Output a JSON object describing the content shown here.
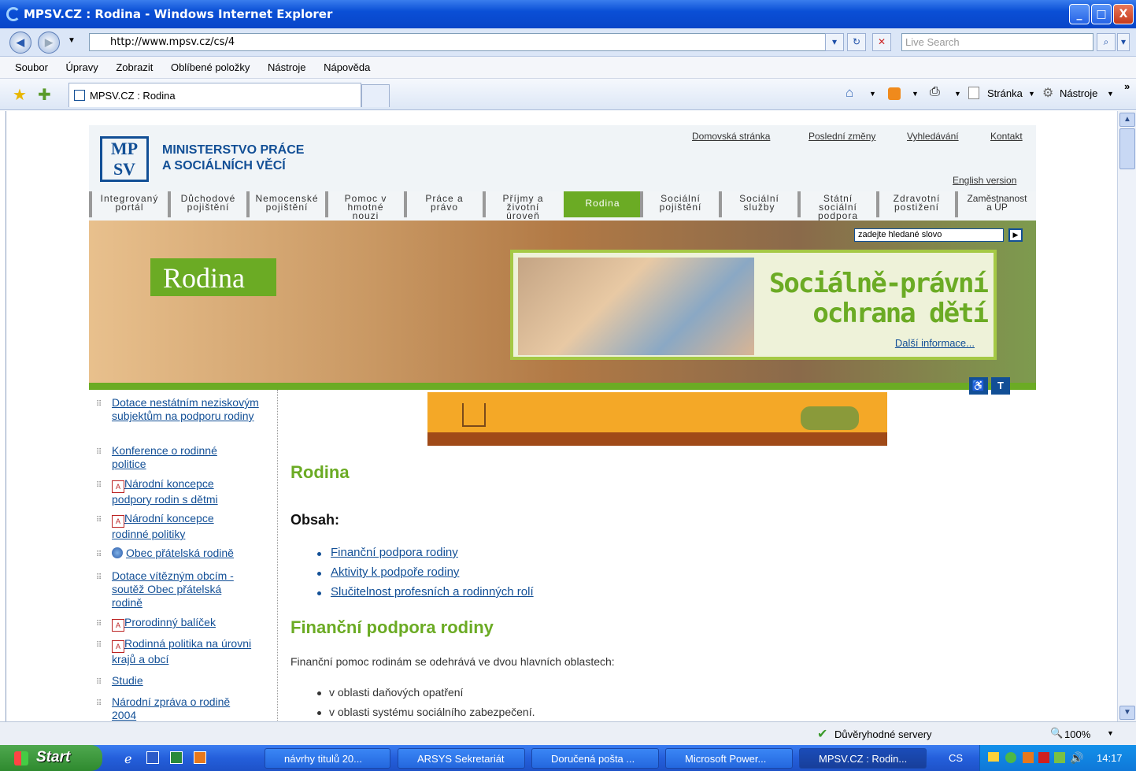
{
  "window": {
    "title": "MPSV.CZ : Rodina - Windows Internet Explorer",
    "min": "_",
    "max": "□",
    "close": "X"
  },
  "address": {
    "url": "http://www.mpsv.cz/cs/4",
    "search_placeholder": "Live Search"
  },
  "menu": [
    "Soubor",
    "Úpravy",
    "Zobrazit",
    "Oblíbené položky",
    "Nástroje",
    "Nápověda"
  ],
  "tab": {
    "label": "MPSV.CZ : Rodina"
  },
  "commands": {
    "page": "Stránka",
    "tools": "Nástroje",
    "more": "»"
  },
  "site": {
    "logo": "MP SV",
    "ministry_line1": "MINISTERSTVO PRÁCE",
    "ministry_line2": "A SOCIÁLNÍCH VĚCÍ",
    "top_links": [
      "Domovská stránka",
      "Poslední změny",
      "Vyhledávání",
      "Kontakt"
    ],
    "english": "English version",
    "nav": [
      {
        "l1": "Integrovaný",
        "l2": "portál"
      },
      {
        "l1": "Důchodové",
        "l2": "pojištění"
      },
      {
        "l1": "Nemocenské",
        "l2": "pojištění"
      },
      {
        "l1": "Pomoc v",
        "l2": "hmotné",
        "l3": "nouzi"
      },
      {
        "l1": "Práce a",
        "l2": "právo"
      },
      {
        "l1": "Příjmy a",
        "l2": "životní",
        "l3": "úroveň"
      },
      {
        "l1": "Rodina"
      },
      {
        "l1": "Sociální",
        "l2": "pojištění"
      },
      {
        "l1": "Sociální",
        "l2": "služby"
      },
      {
        "l1": "Státní",
        "l2": "sociální",
        "l3": "podpora"
      },
      {
        "l1": "Zdravotní",
        "l2": "postižení"
      },
      {
        "l1": "Zaměstnanost",
        "l2": "a ÚP"
      }
    ],
    "search_placeholder": "zadejte hledané slovo",
    "banner_label": "Rodina",
    "promo_title": "Sociálně-právní ochrana dětí",
    "promo_more": "Další informace..."
  },
  "left_menu": [
    {
      "text": "Dotace nestátním neziskovým subjektům na podporu rodiny"
    },
    {
      "text": "Konference o rodinné politice"
    },
    {
      "text": "Národní koncepce podpory rodin s dětmi",
      "icon": "pdf-icon"
    },
    {
      "text": "Národní koncepce rodinné politiky",
      "icon": "pdf-icon"
    },
    {
      "text": "Obec přátelská rodině",
      "icon": "globe-icon"
    },
    {
      "text": "Dotace vítězným obcím - soutěž Obec přátelská rodině"
    },
    {
      "text": "Prorodinný balíček",
      "icon": "pdf-icon"
    },
    {
      "text": "Rodinná politika na úrovni krajů a obcí",
      "icon": "pdf-icon"
    },
    {
      "text": "Studie"
    },
    {
      "text": "Národní zpráva o rodině 2004"
    }
  ],
  "content": {
    "title": "Rodina",
    "toc_heading": "Obsah:",
    "toc": [
      "Finanční podpora rodiny",
      "Aktivity k podpoře rodiny",
      "Slučitelnost profesních a rodinných rolí"
    ],
    "section_title": "Finanční podpora rodiny",
    "intro": "Finanční pomoc rodinám se odehrává ve dvou hlavních oblastech:",
    "bullets": [
      "v oblasti daňových opatření",
      "v oblasti systému sociálního zabezpečení."
    ]
  },
  "status": {
    "zone": "Důvěryhodné servery",
    "zoom": "100%"
  },
  "taskbar": {
    "start": "Start",
    "tasks": [
      "návrhy titulů 20...",
      "ARSYS Sekretariát",
      "Doručená pošta ...",
      "Microsoft Power...",
      "MPSV.CZ : Rodin..."
    ],
    "lang": "CS",
    "clock": "14:17"
  }
}
